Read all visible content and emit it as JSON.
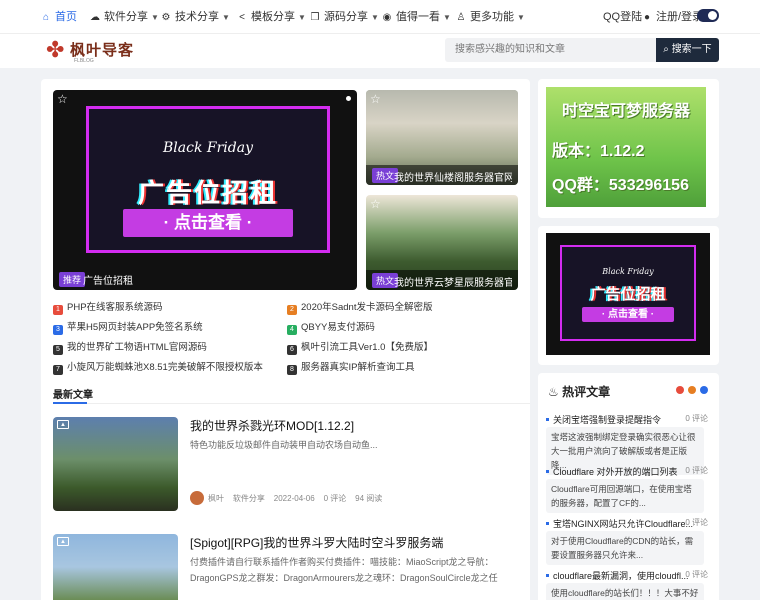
{
  "nav": {
    "items": [
      {
        "label": "首页",
        "icon": "home-icon",
        "glyph": "⌂"
      },
      {
        "label": "软件分享",
        "icon": "cloud-download-icon",
        "glyph": "☁"
      },
      {
        "label": "技术分享",
        "icon": "gear-icon",
        "glyph": "⚙"
      },
      {
        "label": "模板分享",
        "icon": "share-icon",
        "glyph": "<"
      },
      {
        "label": "源码分享",
        "icon": "code-icon",
        "glyph": "❒"
      },
      {
        "label": "值得一看",
        "icon": "eye-icon",
        "glyph": "◉"
      },
      {
        "label": "更多功能",
        "icon": "flask-icon",
        "glyph": "♙"
      }
    ],
    "qq_login": "QQ登陆",
    "register": "注册/登录"
  },
  "header": {
    "logo_text": "枫叶导客",
    "logo_sub": "FLBLOG",
    "search_placeholder": "搜索感兴趣的知识和文章",
    "search_button": "搜索一下"
  },
  "slider": {
    "ad_line1": "Black Friday",
    "ad_title": "广告位招租",
    "ad_button": "· 点击查看 ·",
    "tag": "推荐",
    "caption": "广告位招租"
  },
  "side_thumbs": [
    {
      "tag": "热文",
      "caption": "我的世界仙楼阁服务器官网H..."
    },
    {
      "tag": "热文",
      "caption": "我的世界云梦星辰服务器官网..."
    }
  ],
  "links": [
    {
      "num": "1",
      "color": "#e74c3c",
      "label": "PHP在线客服系统源码"
    },
    {
      "num": "2",
      "color": "#e67e22",
      "label": "2020年Sadnt发卡源码全解密版"
    },
    {
      "num": "3",
      "color": "#2b6be6",
      "label": "苹果H5网页封装APP免签名系统"
    },
    {
      "num": "4",
      "color": "#27ae60",
      "label": "QBYY易支付源码"
    },
    {
      "num": "5",
      "color": "#333333",
      "label": "我的世界矿工物语HTML官网源码"
    },
    {
      "num": "6",
      "color": "#333333",
      "label": "枫叶引流工具Ver1.0【免费版】"
    },
    {
      "num": "7",
      "color": "#333333",
      "label": "小旋风万能蜘蛛池X8.51完美破解不限授权版本"
    },
    {
      "num": "8",
      "color": "#333333",
      "label": "服务器真实IP解析查询工具"
    }
  ],
  "latest": {
    "title": "最新文章",
    "posts": [
      {
        "title": "我的世界杀戮光环MOD[1.12.2]",
        "desc": "特色功能反垃圾邮件自动装甲自动农场自动鱼...",
        "author": "枫叶",
        "category": "软件分享",
        "date": "2022-04-06",
        "comments": "0 评论",
        "views": "94 阅读"
      },
      {
        "title": "[Spigot][RPG]我的世界斗罗大陆时空斗罗服务端",
        "desc": "付费插件请自行联系插件作者购买付费插件：喵技能：MiaoScript龙之导航：DragonGPS龙之群发：DragonArmourers龙之魂环：DragonSoulCircle龙之任务：DragonQues..."
      }
    ]
  },
  "sidebar": {
    "ad1": {
      "line1": "时空宝可梦服务器",
      "line2": "版本：1.12.2",
      "line3": "QQ群：533296156"
    },
    "ad2": {
      "line1": "Black Friday",
      "title": "广告位招租",
      "button": "· 点击查看 ·"
    },
    "hot": {
      "title": "热评文章",
      "items": [
        {
          "title": "关闭宝塔强制登录提醒指令",
          "count": "0 评论",
          "snippet": "宝塔这波强制绑定登录确实很恶心让很大一批用户流向了破解版或者是正版降..."
        },
        {
          "title": "Cloudflare 对外开放的端口列表",
          "count": "0 评论",
          "snippet": "Cloudflare可用回源端口，在使用宝塔的服务器，配置了CF的..."
        },
        {
          "title": "宝塔NGINX网站只允许Cloudflare...",
          "count": "0 评论",
          "snippet": "对于使用Cloudflare的CDN的站长，需要设置服务器只允许来..."
        },
        {
          "title": "cloudflare最新漏洞，使用cloudfl...",
          "count": "0 评论",
          "snippet": "使用cloudflare的站长们！！！大事不好"
        }
      ]
    }
  }
}
